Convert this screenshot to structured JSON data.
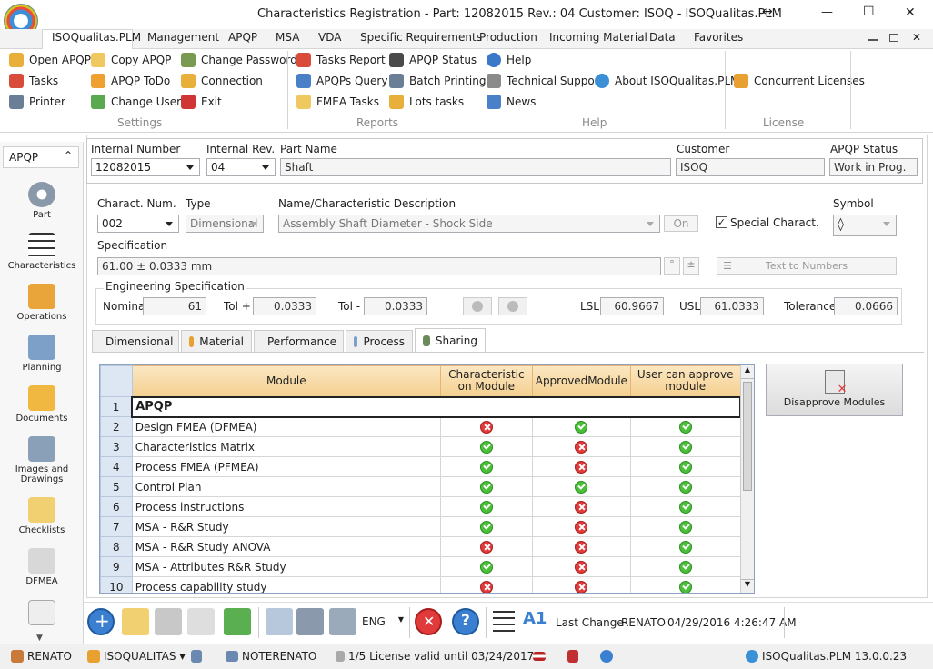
{
  "window": {
    "title": "Characteristics Registration - Part: 12082015 Rev.: 04 Customer: ISOQ - ISOQualitas.PLM",
    "minimize": "—",
    "maximize": "☐",
    "close": "✕",
    "resize": "↔"
  },
  "menu": {
    "tabs": [
      "ISOQualitas.PLM",
      "Management",
      "APQP",
      "MSA",
      "VDA",
      "Specific Requirements",
      "Production",
      "Incoming Material",
      "Data",
      "Favorites"
    ]
  },
  "ribbon": {
    "settings": {
      "label": "Settings",
      "items": [
        "Open APQP",
        "Copy APQP",
        "Change Password",
        "Tasks",
        "APQP ToDo",
        "Connection",
        "Printer",
        "Change User",
        "Exit"
      ]
    },
    "reports": {
      "label": "Reports",
      "items": [
        "Tasks Report",
        "APQP Status",
        "APQPs Query",
        "Batch Printing",
        "FMEA Tasks",
        "Lots tasks"
      ]
    },
    "help": {
      "label": "Help",
      "items": [
        "Help",
        "Technical Support",
        "About ISOQualitas.PLM",
        "News"
      ]
    },
    "license": {
      "label": "License",
      "items": [
        "Concurrent Licenses"
      ]
    }
  },
  "nav": {
    "header": "APQP",
    "items": [
      "Part",
      "Characteristics",
      "Operations",
      "Planning",
      "Documents",
      "Images and Drawings",
      "Checklists",
      "DFMEA"
    ]
  },
  "part": {
    "internal_number_label": "Internal Number",
    "internal_number": "12082015",
    "internal_rev_label": "Internal Rev.",
    "internal_rev": "04",
    "part_name_label": "Part Name",
    "part_name": "Shaft",
    "customer_label": "Customer",
    "customer": "ISOQ",
    "status_label": "APQP Status",
    "status": "Work in Prog."
  },
  "charact": {
    "num_label": "Charact. Num.",
    "num": "002",
    "type_label": "Type",
    "type": "Dimensional",
    "desc_label": "Name/Characteristic Description",
    "desc": "Assembly Shaft Diameter - Shock Side",
    "on_btn": "On",
    "special_label": "Special Charact.",
    "symbol_label": "Symbol",
    "symbol": "◊",
    "spec_label": "Specification",
    "spec": "61.00  ± 0.0333 mm",
    "spec_btn1": "°",
    "spec_btn2": "±",
    "text_to_numbers": "Text to Numbers"
  },
  "eng": {
    "label": "Engineering Specification",
    "nominal_label": "Nominal",
    "nominal": "61",
    "tolp_label": "Tol +",
    "tolp": "0.0333",
    "tolm_label": "Tol -",
    "tolm": "0.0333",
    "lsl_label": "LSL",
    "lsl": "60.9667",
    "usl_label": "USL",
    "usl": "61.0333",
    "tol_label": "Tolerance",
    "tol": "0.0666"
  },
  "tabs": [
    "Dimensional",
    "Material",
    "Performance",
    "Process",
    "Sharing"
  ],
  "grid": {
    "headers": [
      "Module",
      "Characteristic on Module",
      "ApprovedModule",
      "User can approve module"
    ],
    "group": {
      "num": "1",
      "label": "APQP"
    },
    "rows": [
      {
        "num": "2",
        "module": "Design FMEA (DFMEA)",
        "c": "no",
        "a": "ok",
        "u": "ok"
      },
      {
        "num": "3",
        "module": "Characteristics Matrix",
        "c": "ok",
        "a": "no",
        "u": "ok"
      },
      {
        "num": "4",
        "module": "Process FMEA (PFMEA)",
        "c": "ok",
        "a": "no",
        "u": "ok"
      },
      {
        "num": "5",
        "module": "Control Plan",
        "c": "ok",
        "a": "ok",
        "u": "ok"
      },
      {
        "num": "6",
        "module": "Process instructions",
        "c": "ok",
        "a": "no",
        "u": "ok"
      },
      {
        "num": "7",
        "module": "MSA - R&R Study",
        "c": "ok",
        "a": "no",
        "u": "ok"
      },
      {
        "num": "8",
        "module": "MSA - R&R Study ANOVA",
        "c": "no",
        "a": "no",
        "u": "ok"
      },
      {
        "num": "9",
        "module": "MSA - Attributes R&R Study",
        "c": "ok",
        "a": "no",
        "u": "ok"
      },
      {
        "num": "10",
        "module": "Process capability study",
        "c": "no",
        "a": "no",
        "u": "ok"
      }
    ]
  },
  "disapprove_btn": "Disapprove Modules",
  "toolbar": {
    "lang": "ENG",
    "last_change_label": "Last Change",
    "last_change_user": "RENATO",
    "last_change_date": "04/29/2016 4:26:47 AM"
  },
  "status": {
    "user": "RENATO",
    "company": "ISOQUALITAS",
    "machine": "NOTERENATO",
    "license": "1/5 License valid until 03/24/2017",
    "app": "ISOQualitas.PLM 13.0.0.23"
  },
  "colors": {
    "accent": "#2b579a",
    "ok": "#4cbf3a",
    "no": "#e13a3a",
    "grid_header": "#f7d9a4"
  }
}
